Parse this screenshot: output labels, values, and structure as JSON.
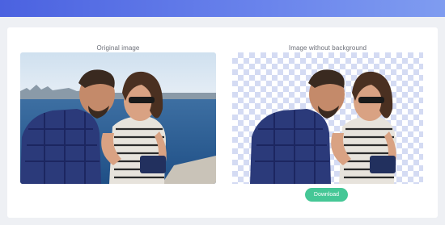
{
  "panels": {
    "left_title": "Original image",
    "right_title": "Image without background"
  },
  "actions": {
    "download_label": "Download"
  },
  "colors": {
    "banner": "#5b74e8",
    "accent_button": "#45c796",
    "checker": "#d4dbf3"
  }
}
